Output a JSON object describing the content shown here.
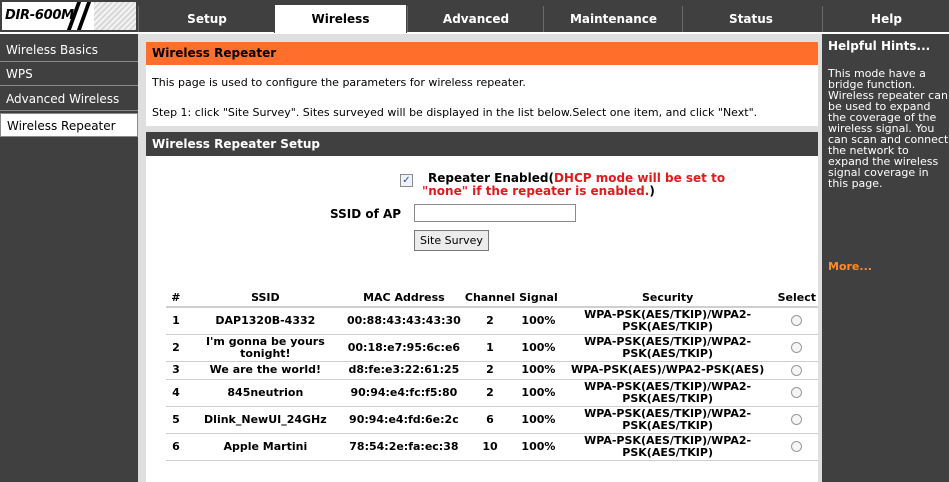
{
  "header": {
    "logo_text": "DIR-600M",
    "tabs": [
      {
        "label": "Setup",
        "active": false
      },
      {
        "label": "Wireless",
        "active": true
      },
      {
        "label": "Advanced",
        "active": false
      },
      {
        "label": "Maintenance",
        "active": false
      },
      {
        "label": "Status",
        "active": false
      },
      {
        "label": "Help",
        "active": false
      }
    ]
  },
  "sidebar": {
    "items": [
      {
        "label": "Wireless Basics",
        "active": false
      },
      {
        "label": "WPS",
        "active": false
      },
      {
        "label": "Advanced Wireless",
        "active": false
      },
      {
        "label": "Wireless Repeater",
        "active": true
      }
    ]
  },
  "repeater_panel": {
    "title": "Wireless Repeater",
    "description": "This page is used to configure the parameters for wireless repeater.",
    "step": "Step 1: click \"Site Survey\". Sites surveyed will be displayed in the list below.Select one item, and click \"Next\"."
  },
  "setup_panel": {
    "title": "Wireless Repeater Setup",
    "repeater_enabled_checked": true,
    "repeater_label": "Repeater Enabled(",
    "repeater_note": "DHCP mode will be set to \"none\" if the repeater is enabled.",
    "repeater_label_end": ")",
    "ssid_label": "SSID of AP",
    "ssid_value": "",
    "site_survey_label": "Site Survey"
  },
  "sites_table": {
    "columns": [
      "#",
      "SSID",
      "MAC Address",
      "Channel",
      "Signal",
      "Security",
      "Select"
    ],
    "rows": [
      {
        "num": "1",
        "ssid": "DAP1320B-4332",
        "mac": "00:88:43:43:43:30",
        "channel": "2",
        "signal": "100%",
        "security": "WPA-PSK(AES/TKIP)/WPA2-PSK(AES/TKIP)"
      },
      {
        "num": "2",
        "ssid": "I'm gonna be yours tonight!",
        "mac": "00:18:e7:95:6c:e6",
        "channel": "1",
        "signal": "100%",
        "security": "WPA-PSK(AES/TKIP)/WPA2-PSK(AES/TKIP)"
      },
      {
        "num": "3",
        "ssid": "We are the world!",
        "mac": "d8:fe:e3:22:61:25",
        "channel": "2",
        "signal": "100%",
        "security": "WPA-PSK(AES)/WPA2-PSK(AES)"
      },
      {
        "num": "4",
        "ssid": "845neutrion",
        "mac": "90:94:e4:fc:f5:80",
        "channel": "2",
        "signal": "100%",
        "security": "WPA-PSK(AES/TKIP)/WPA2-PSK(AES/TKIP)"
      },
      {
        "num": "5",
        "ssid": "Dlink_NewUI_24GHz",
        "mac": "90:94:e4:fd:6e:2c",
        "channel": "6",
        "signal": "100%",
        "security": "WPA-PSK(AES/TKIP)/WPA2-PSK(AES/TKIP)"
      },
      {
        "num": "6",
        "ssid": "Apple Martini",
        "mac": "78:54:2e:fa:ec:38",
        "channel": "10",
        "signal": "100%",
        "security": "WPA-PSK(AES/TKIP)/WPA2-PSK(AES/TKIP)"
      }
    ]
  },
  "help": {
    "title": "Helpful Hints...",
    "text": "This mode have a bridge function. Wireless repeater can be used to expand the coverage of the wireless signal. You can scan and connect the network to expand the wireless signal coverage in this page.",
    "more": "More..."
  },
  "colors": {
    "chrome": "#404040",
    "orange_title": "#ff6f2b",
    "warning_red": "#e01a1a",
    "content_bg": "#dfdfdf"
  }
}
